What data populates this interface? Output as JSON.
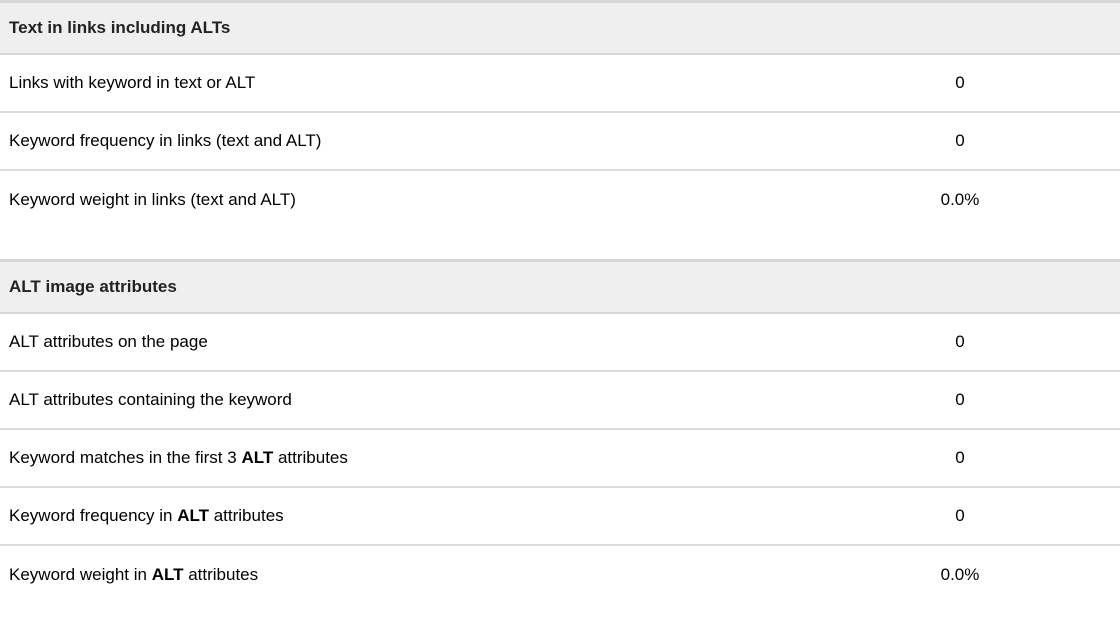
{
  "links_section": {
    "title": "Text in links including ALTs",
    "rows": [
      {
        "label": "Links with keyword in text or ALT",
        "value": "0"
      },
      {
        "label": "Keyword frequency in links (text and ALT)",
        "value": "0"
      },
      {
        "label": "Keyword weight in links (text and ALT)",
        "value": "0.0%"
      }
    ]
  },
  "alt_section": {
    "title": "ALT image attributes",
    "rows": [
      {
        "label": "ALT attributes on the page",
        "value": "0"
      },
      {
        "label": "ALT attributes containing the keyword",
        "value": "0"
      },
      {
        "label_pre": "Keyword matches in the first 3 ",
        "label_bold": "ALT",
        "label_post": " attributes",
        "value": "0"
      },
      {
        "label_pre": "Keyword frequency in ",
        "label_bold": "ALT",
        "label_post": " attributes",
        "value": "0"
      },
      {
        "label_pre": "Keyword weight in ",
        "label_bold": "ALT",
        "label_post": " attributes",
        "value": "0.0%"
      }
    ]
  }
}
